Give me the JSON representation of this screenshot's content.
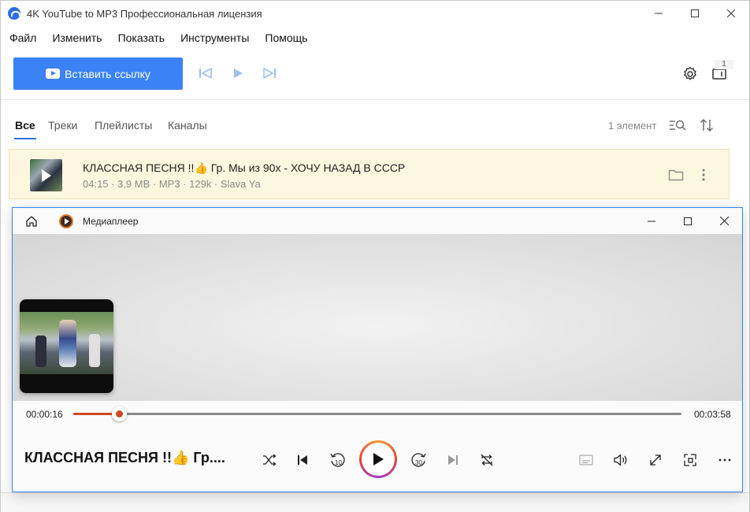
{
  "window": {
    "title": "4K YouTube to MP3 Профессиональная лицензия",
    "minimize_icon": "minimize-icon",
    "maximize_icon": "maximize-icon",
    "close_icon": "close-icon"
  },
  "menu": {
    "items": [
      "Файл",
      "Изменить",
      "Показать",
      "Инструменты",
      "Помощь"
    ]
  },
  "toolbar": {
    "paste_label": "Вставить ссылку",
    "badge_count": "1",
    "accent": "#3b82f6"
  },
  "tabs": {
    "items": [
      "Все",
      "Треки",
      "Плейлисты",
      "Каналы"
    ],
    "active": "Все",
    "count_label": "1 элемент"
  },
  "track": {
    "title": "КЛАССНАЯ ПЕСНЯ !!👍 Гр. Мы из 90х  - ХОЧУ НАЗАД В СССР",
    "meta": "04:15 · 3,9 MB · MP3 · 129k · Slava Ya"
  },
  "player": {
    "title": "Медиаплеер",
    "time_current": "00:00:16",
    "time_total": "00:03:58",
    "progress_fraction": 0.076,
    "now_playing": "КЛАССНАЯ ПЕСНЯ !!👍 Гр....",
    "skip_back_label": "10",
    "skip_forward_label": "30",
    "progress_color": "#d2461f"
  }
}
